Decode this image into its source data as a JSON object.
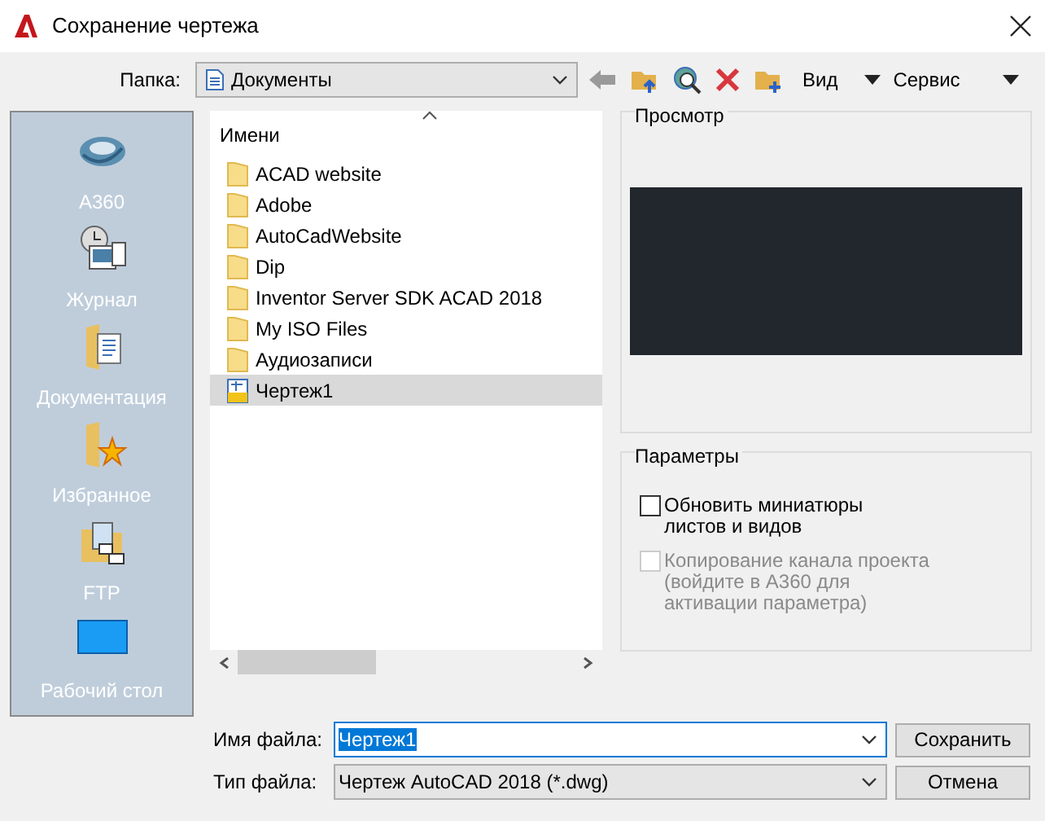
{
  "window": {
    "title": "Сохранение чертежа"
  },
  "toolbar": {
    "folder_label": "Папка:",
    "folder": "Документы",
    "view": "Вид",
    "tools": "Сервис"
  },
  "sidebar": {
    "items": [
      {
        "label": "A360",
        "kind": "cloud"
      },
      {
        "label": "Журнал",
        "kind": "history"
      },
      {
        "label": "Документация",
        "kind": "documents"
      },
      {
        "label": "Избранное",
        "kind": "favorites"
      },
      {
        "label": "FTP",
        "kind": "ftp"
      },
      {
        "label": "Рабочий стол",
        "kind": "desktop"
      }
    ]
  },
  "file_list": {
    "column": "Имени",
    "items": [
      {
        "name": "ACAD website",
        "kind": "folder",
        "selected": false
      },
      {
        "name": "Adobe",
        "kind": "folder",
        "selected": false
      },
      {
        "name": "AutoCadWebsite",
        "kind": "folder",
        "selected": false
      },
      {
        "name": "Dip",
        "kind": "folder",
        "selected": false
      },
      {
        "name": "Inventor Server SDK ACAD 2018",
        "kind": "folder",
        "selected": false
      },
      {
        "name": "My ISO Files",
        "kind": "folder",
        "selected": false
      },
      {
        "name": "Аудиозаписи",
        "kind": "folder",
        "selected": false
      },
      {
        "name": "Чертеж1",
        "kind": "drawing",
        "selected": true
      }
    ]
  },
  "preview": {
    "title": "Просмотр"
  },
  "options": {
    "title": "Параметры",
    "items": [
      {
        "label": "Обновить миниатюры листов и видов",
        "checked": false,
        "disabled": false
      },
      {
        "label": "Копирование канала проекта (войдите в A360 для активации параметра)",
        "checked": false,
        "disabled": true
      }
    ]
  },
  "file_name": {
    "label": "Имя файла:",
    "value": "Чертеж1"
  },
  "file_type": {
    "label": "Тип файла:",
    "value": "Чертеж AutoCAD 2018 (*.dwg)"
  },
  "buttons": {
    "save": "Сохранить",
    "cancel": "Отмена"
  }
}
